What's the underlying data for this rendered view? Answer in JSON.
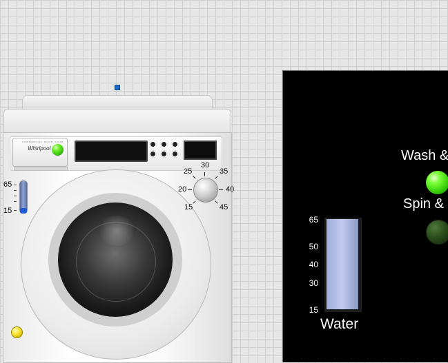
{
  "washer": {
    "brand": "Whirlpool",
    "brand_sub": "COMMERCIAL MULTI-LOAD",
    "small_thermo": {
      "max_label": "65",
      "min_label": "15",
      "level": 0.05
    },
    "knob": {
      "labels": [
        "15",
        "20",
        "25",
        "30",
        "35",
        "40",
        "45"
      ]
    },
    "colors": {
      "power_led": "#5ee61f",
      "yellow_led": "#f1da1f",
      "thermo_fill": "#1f5bd6"
    }
  },
  "panel": {
    "wash_label": "Wash &",
    "spin_label": "Spin &",
    "wash_led_on": true,
    "spin_led_on": false,
    "tank": {
      "ticks": [
        "65",
        "50",
        "40",
        "30",
        "15"
      ],
      "label": "Water",
      "level": 1.0
    },
    "colors": {
      "background": "#000000",
      "led_on": "#7cff3a",
      "led_off": "#2c4d1c",
      "water": "#b7c2e8"
    }
  }
}
